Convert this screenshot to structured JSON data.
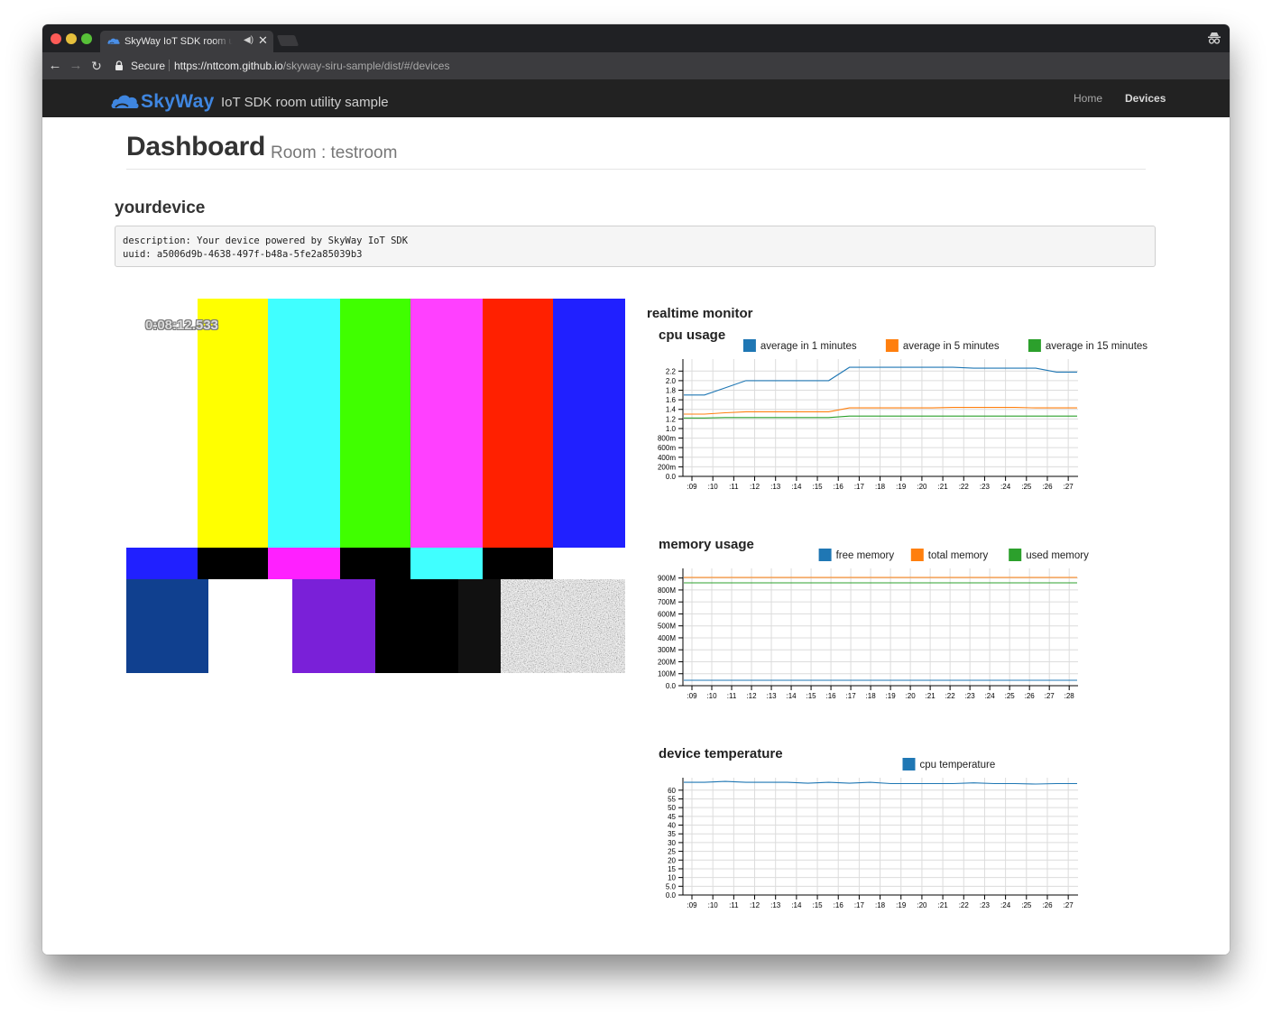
{
  "browser": {
    "tab_title": "SkyWay IoT SDK room utility sample",
    "secure_label": "Secure",
    "url_host": "https://nttcom.github.io",
    "url_path": "/skyway-siru-sample/dist/#/devices"
  },
  "navbar": {
    "brand_name": "SkyWay",
    "brand_subtitle": "IoT SDK room utility sample",
    "links": [
      "Home",
      "Devices"
    ],
    "active_link": "Devices"
  },
  "header": {
    "title": "Dashboard",
    "subtitle": "Room : testroom"
  },
  "device": {
    "name": "yourdevice",
    "description_line": "description: Your device powered by SkyWay IoT SDK",
    "uuid_line": "uuid: a5006d9b-4638-497f-b48a-5fe2a85039b3"
  },
  "video": {
    "timestamp": "0:08:12.533"
  },
  "monitor": {
    "title": "realtime monitor"
  },
  "colors": {
    "series_blue": "#1f77b4",
    "series_orange": "#ff7f0e",
    "series_green": "#2ca02c",
    "navbar_bg": "#222222",
    "brand_blue": "#3f86e0"
  },
  "chart_data": [
    {
      "id": "cpu",
      "type": "line",
      "title": "cpu usage",
      "x": [
        ":09",
        ":10",
        ":11",
        ":12",
        ":13",
        ":14",
        ":15",
        ":16",
        ":17",
        ":18",
        ":19",
        ":20",
        ":21",
        ":22",
        ":23",
        ":24",
        ":25",
        ":26",
        ":27"
      ],
      "y_ticks": [
        "0.0",
        "200m",
        "400m",
        "600m",
        "800m",
        "1.0",
        "1.2",
        "1.4",
        "1.6",
        "1.8",
        "2.0",
        "2.2"
      ],
      "ylim": [
        0,
        2.3
      ],
      "grid": true,
      "legend": "top",
      "series": [
        {
          "name": "average in 1 minutes",
          "color": "#1f77b4",
          "values": [
            1.7,
            1.7,
            1.85,
            2.0,
            2.0,
            2.0,
            2.0,
            2.0,
            2.28,
            2.28,
            2.28,
            2.28,
            2.28,
            2.28,
            2.26,
            2.26,
            2.26,
            2.26,
            2.18,
            2.18
          ]
        },
        {
          "name": "average in 5 minutes",
          "color": "#ff7f0e",
          "values": [
            1.3,
            1.3,
            1.33,
            1.35,
            1.35,
            1.35,
            1.35,
            1.35,
            1.43,
            1.43,
            1.43,
            1.43,
            1.43,
            1.44,
            1.44,
            1.44,
            1.44,
            1.43,
            1.43,
            1.43
          ]
        },
        {
          "name": "average in 15 minutes",
          "color": "#2ca02c",
          "values": [
            1.22,
            1.22,
            1.23,
            1.23,
            1.23,
            1.23,
            1.23,
            1.23,
            1.26,
            1.26,
            1.26,
            1.26,
            1.26,
            1.26,
            1.26,
            1.26,
            1.26,
            1.26,
            1.26,
            1.26
          ]
        }
      ]
    },
    {
      "id": "memory",
      "type": "line",
      "title": "memory usage",
      "x": [
        ":09",
        ":10",
        ":11",
        ":12",
        ":13",
        ":14",
        ":15",
        ":16",
        ":17",
        ":18",
        ":19",
        ":20",
        ":21",
        ":22",
        ":23",
        ":24",
        ":25",
        ":26",
        ":27",
        ":28"
      ],
      "y_ticks": [
        "0.0",
        "100M",
        "200M",
        "300M",
        "400M",
        "500M",
        "600M",
        "700M",
        "800M",
        "900M"
      ],
      "ylim": [
        0,
        920
      ],
      "grid": true,
      "legend": "top",
      "series": [
        {
          "name": "free memory",
          "color": "#1f77b4",
          "values": [
            45,
            45,
            45,
            45,
            45,
            45,
            45,
            45,
            45,
            45,
            45,
            45,
            45,
            45,
            45,
            45,
            45,
            45,
            45,
            45,
            45
          ]
        },
        {
          "name": "total memory",
          "color": "#ff7f0e",
          "values": [
            905,
            905,
            905,
            905,
            905,
            905,
            905,
            905,
            905,
            905,
            905,
            905,
            905,
            905,
            905,
            905,
            905,
            905,
            905,
            905,
            905
          ]
        },
        {
          "name": "used memory",
          "color": "#2ca02c",
          "values": [
            860,
            860,
            860,
            860,
            860,
            860,
            860,
            860,
            860,
            860,
            860,
            860,
            860,
            860,
            860,
            860,
            860,
            860,
            860,
            860,
            860
          ]
        }
      ]
    },
    {
      "id": "temperature",
      "type": "line",
      "title": "device temperature",
      "x": [
        ":09",
        ":10",
        ":11",
        ":12",
        ":13",
        ":14",
        ":15",
        ":16",
        ":17",
        ":18",
        ":19",
        ":20",
        ":21",
        ":22",
        ":23",
        ":24",
        ":25",
        ":26",
        ":27"
      ],
      "y_ticks": [
        "0.0",
        "5.0",
        "10",
        "15",
        "20",
        "25",
        "30",
        "35",
        "40",
        "45",
        "50",
        "55",
        "60"
      ],
      "ylim": [
        0,
        63
      ],
      "grid": true,
      "legend": "top",
      "series": [
        {
          "name": "cpu temperature",
          "color": "#1f77b4",
          "values": [
            64.5,
            64.5,
            65,
            64.5,
            64.5,
            64.5,
            64,
            64.5,
            64,
            64.5,
            63.8,
            63.8,
            63.8,
            63.8,
            64.2,
            63.8,
            63.8,
            63.5,
            63.8,
            63.8
          ]
        }
      ]
    }
  ]
}
